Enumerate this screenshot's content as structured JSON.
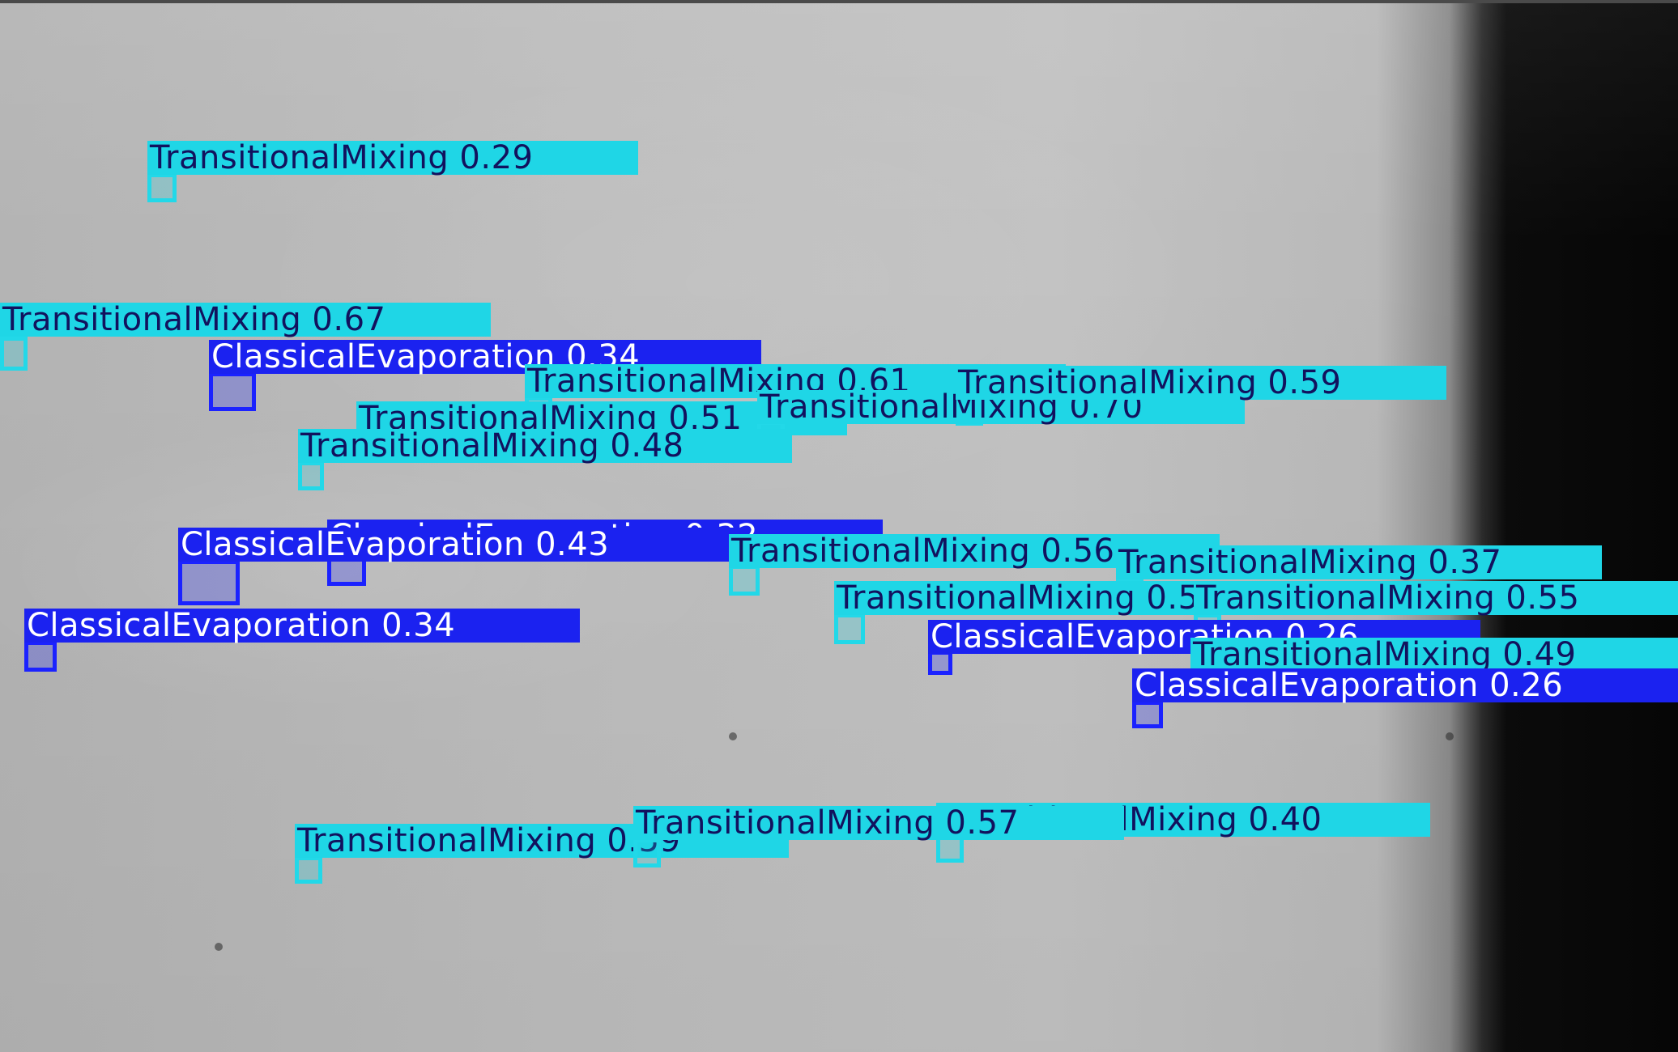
{
  "image": {
    "description_kind": "spray-detection-overlay"
  },
  "colors": {
    "transitional_mixing": "#1fd6e6",
    "classical_evaporation": "#1b22f0",
    "label_text_dark": "#12125e",
    "label_text_light": "#ffffff"
  },
  "detections": [
    {
      "class": "TransitionalMixing",
      "score": "0.29",
      "label": "TransitionalMixing  0.29"
    },
    {
      "class": "TransitionalMixing",
      "score": "0.67",
      "label": "TransitionalMixing  0.67"
    },
    {
      "class": "ClassicalEvaporation",
      "score": "0.34",
      "label": "ClassicalEvaporation  0.34"
    },
    {
      "class": "TransitionalMixing",
      "score": "0.61",
      "label": "TransitionalMixing  0.61"
    },
    {
      "class": "TransitionalMixing",
      "score": "0.59",
      "label": "TransitionalMixing  0.59"
    },
    {
      "class": "TransitionalMixing",
      "score": "0.51",
      "label": "TransitionalMixing  0.51"
    },
    {
      "class": "TransitionalMixing",
      "score": "0.70",
      "label": "TransitionalMixing  0.70"
    },
    {
      "class": "TransitionalMixing",
      "score": "0.48",
      "label": "TransitionalMixing  0.48"
    },
    {
      "class": "ClassicalEvaporation",
      "score": "0.32",
      "label": "ClassicalEvaporation  0.32"
    },
    {
      "class": "ClassicalEvaporation",
      "score": "0.43",
      "label": "ClassicalEvaporation  0.43"
    },
    {
      "class": "TransitionalMixing",
      "score": "0.56",
      "label": "TransitionalMixing  0.56"
    },
    {
      "class": "TransitionalMixing",
      "score": "0.37",
      "label": "TransitionalMixing  0.37"
    },
    {
      "class": "ClassicalEvaporation",
      "score": "0.34",
      "label": "ClassicalEvaporation  0.34"
    },
    {
      "class": "TransitionalMixing",
      "score": "0.55",
      "label": "TransitionalMixing  0.55"
    },
    {
      "class": "TransitionalMixing",
      "score": "0.55",
      "label": "TransitionalMixing  0.55"
    },
    {
      "class": "ClassicalEvaporation",
      "score": "0.26",
      "label": "ClassicalEvaporation  0.26"
    },
    {
      "class": "TransitionalMixing",
      "score": "0.49",
      "label": "TransitionalMixing  0.49"
    },
    {
      "class": "ClassicalEvaporation",
      "score": "0.26",
      "label": "ClassicalEvaporation  0.26"
    },
    {
      "class": "TransitionalMixing",
      "score": "0.40",
      "label": "TransitionalMixing  0.40"
    },
    {
      "class": "TransitionalMixing",
      "score": "0.59",
      "label": "TransitionalMixing  0.59"
    },
    {
      "class": "TransitionalMixing",
      "score": "0.57",
      "label": "TransitionalMixing  0.57"
    }
  ]
}
